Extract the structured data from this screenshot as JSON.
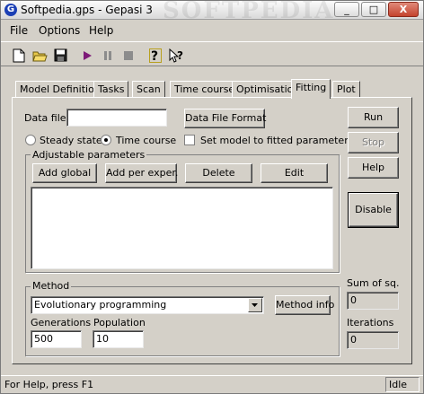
{
  "window": {
    "title": "Softpedia.gps - Gepasi 3",
    "app_icon": "G",
    "watermark": "SOFTPEDIA"
  },
  "title_buttons": {
    "minimize": "_",
    "maximize": "□",
    "close": "X"
  },
  "menu": [
    "File",
    "Options",
    "Help"
  ],
  "toolbar": [
    "new-file-icon",
    "open-folder-icon",
    "save-disk-icon",
    "play-icon",
    "pause-icon",
    "stop-icon",
    "help-icon",
    "context-help-icon"
  ],
  "tabs": [
    "Model Definition",
    "Tasks",
    "Scan",
    "Time course",
    "Optimisation",
    "Fitting",
    "Plot"
  ],
  "active_tab": "Fitting",
  "fitting": {
    "data_file_label": "Data file:",
    "data_file_value": "",
    "data_file_format_button": "Data File Format",
    "steady_state_label": "Steady state",
    "time_course_label": "Time course",
    "selected_mode": "Time course",
    "set_model_label": "Set model to fitted parameters",
    "set_model_checked": false,
    "adjustable_group_label": "Adjustable parameters",
    "add_global_button": "Add global",
    "add_per_exper_button": "Add per exper.",
    "delete_button": "Delete",
    "edit_button": "Edit",
    "method_group_label": "Method",
    "method_value": "Evolutionary programming",
    "method_info_button": "Method info",
    "generations_label": "Generations",
    "generations_value": "500",
    "population_label": "Population",
    "population_value": "10",
    "sum_of_sq_label": "Sum of sq.",
    "sum_of_sq_value": "0",
    "iterations_label": "Iterations",
    "iterations_value": "0"
  },
  "side_buttons": {
    "run": "Run",
    "stop": "Stop",
    "help": "Help",
    "disable": "Disable"
  },
  "status": {
    "left": "For Help, press F1",
    "right": "Idle"
  }
}
